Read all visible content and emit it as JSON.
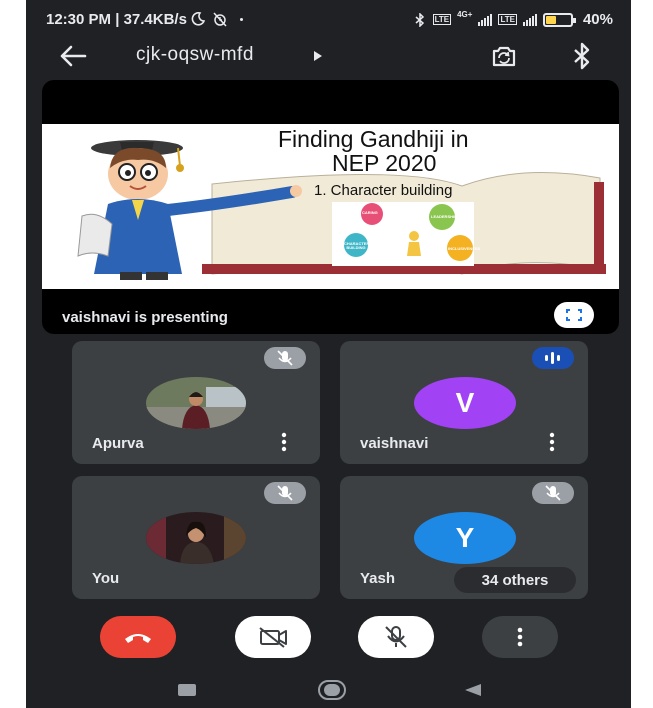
{
  "status_bar": {
    "left_text": "12:30 PM | 37.4KB/s",
    "network": "4G+",
    "battery": "40%",
    "battery_level": 0.4
  },
  "top_bar": {
    "meeting_code": "cjk-oqsw-mfd"
  },
  "presentation": {
    "slide_title_line1": "Finding Gandhiji in",
    "slide_title_line2": "NEP 2020",
    "slide_bullet": "1.  Character building",
    "slide_bubbles": [
      "CARING",
      "LEADERSHIP",
      "CHARACTER BUILDING",
      "INCLUSIVENESS"
    ],
    "presenting_label": "vaishnavi is presenting"
  },
  "participants": [
    {
      "name": "Apurva",
      "avatar": "photo",
      "muted": true
    },
    {
      "name": "vaishnavi",
      "avatar": "letter",
      "letter": "V",
      "avatar_color": "#a142f4",
      "speaking": true
    },
    {
      "name": "You",
      "avatar": "photo",
      "muted": true
    },
    {
      "name": "Yash",
      "avatar": "letter",
      "letter": "Y",
      "avatar_color": "#1e88e5",
      "muted": true
    }
  ],
  "others_count_label": "34 others",
  "controls": {
    "end_call_color": "#ea4335",
    "icons": [
      "end-call-icon",
      "camera-off-icon",
      "mic-off-icon",
      "more-options-icon"
    ]
  },
  "nav_bar": {
    "icons": [
      "recents-icon",
      "home-icon",
      "back-triangle-icon"
    ]
  },
  "colors": {
    "background": "#202124",
    "tile": "#3c4043",
    "speaking_badge": "#1a4fb5"
  }
}
